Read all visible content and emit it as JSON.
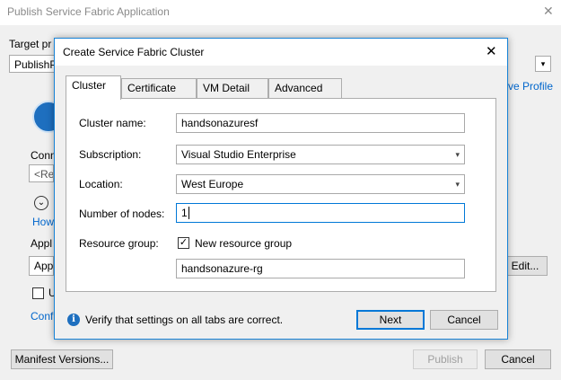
{
  "parent_window": {
    "title": "Publish Service Fabric Application",
    "target_profile_label": "Target pr",
    "profile_value": "PublishP",
    "save_profile_link": "ve Profile",
    "connection_label": "Conn",
    "connection_value": "<Res",
    "how_link": "How",
    "application_label": "Appl",
    "application_value": "Appl",
    "edit_button": "Edit...",
    "checkbox_label": "U",
    "configure_link": "Conf",
    "manifest_button": "Manifest Versions...",
    "publish_button": "Publish",
    "cancel_button": "Cancel"
  },
  "dialog": {
    "title": "Create Service Fabric Cluster",
    "tabs": [
      {
        "label": "Cluster",
        "active": true
      },
      {
        "label": "Certificate",
        "active": false
      },
      {
        "label": "VM Detail",
        "active": false
      },
      {
        "label": "Advanced",
        "active": false
      }
    ],
    "form": {
      "cluster_name_label": "Cluster name:",
      "cluster_name_value": "handsonazuresf",
      "subscription_label": "Subscription:",
      "subscription_value": "Visual Studio Enterprise",
      "location_label": "Location:",
      "location_value": "West Europe",
      "nodes_label": "Number of nodes:",
      "nodes_value": "1",
      "resource_group_label": "Resource group:",
      "new_resource_group_label": "New resource group",
      "new_resource_group_checked": true,
      "resource_group_value": "handsonazure-rg"
    },
    "footer": {
      "info_text": "Verify that settings on all tabs are correct.",
      "next_button": "Next",
      "cancel_button": "Cancel"
    }
  },
  "colors": {
    "accent": "#0078d7",
    "link": "#0066cc",
    "dialog_border": "#1883d7"
  },
  "icons": {
    "close": "close-icon",
    "dropdown": "chevron-down-icon",
    "info": "info-icon",
    "checkmark": "checkmark-icon"
  }
}
